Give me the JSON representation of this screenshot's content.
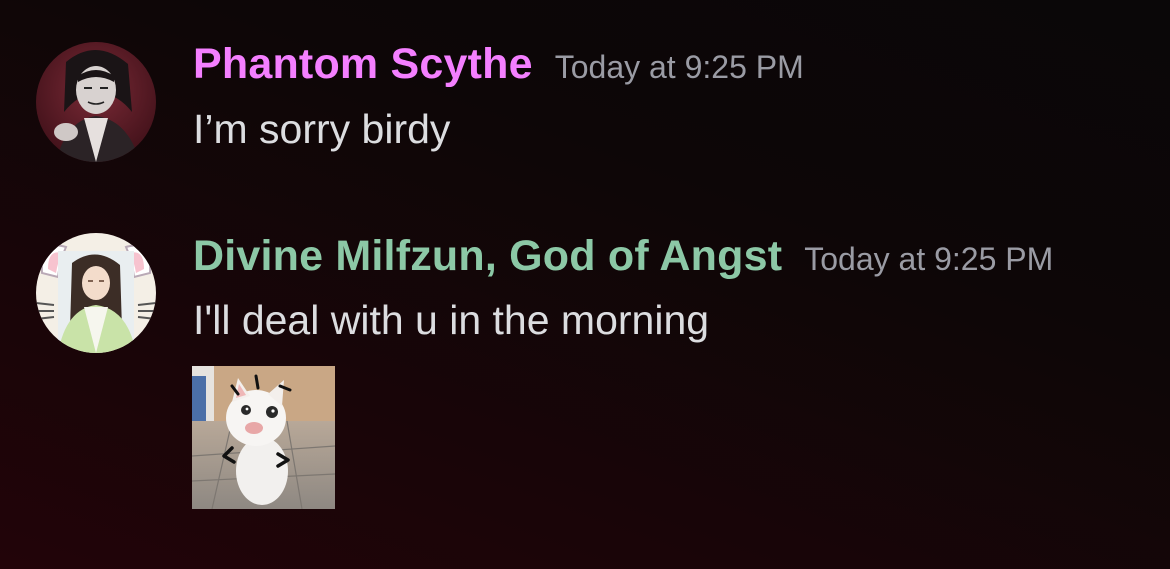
{
  "messages": [
    {
      "username": "Phantom Scythe",
      "username_color": "#f47fff",
      "timestamp": "Today at 9:25 PM",
      "text": "I’m sorry birdy",
      "avatar_icon": "anime-character-avatar"
    },
    {
      "username": "Divine Milfzun, God of Angst",
      "username_color": "#8cc8a6",
      "timestamp": "Today at 9:25 PM",
      "text": "I'll deal with u in the morning",
      "avatar_icon": "anime-character-cat-ear-avatar",
      "attachment": "cat-meme-image"
    }
  ]
}
